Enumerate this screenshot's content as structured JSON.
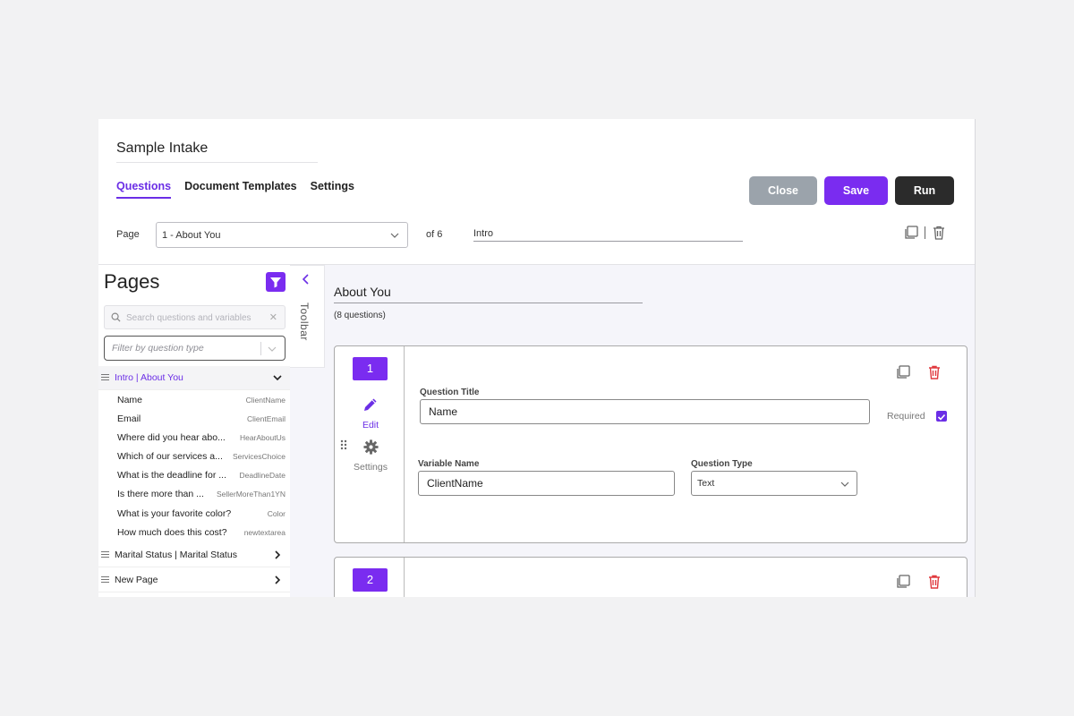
{
  "app": {
    "title": "Sample Intake"
  },
  "tabs": [
    {
      "label": "Questions",
      "active": true
    },
    {
      "label": "Document Templates",
      "active": false
    },
    {
      "label": "Settings",
      "active": false
    }
  ],
  "actions": {
    "close_label": "Close",
    "save_label": "Save",
    "run_label": "Run"
  },
  "page_nav": {
    "label": "Page",
    "selected": "1 - About You",
    "of_label": "of 6",
    "page_name": "Intro"
  },
  "sidebar": {
    "title": "Pages",
    "search_placeholder": "Search questions and variables",
    "filter_placeholder": "Filter by question type",
    "groups": [
      {
        "label": "Intro | About You",
        "expanded": true
      },
      {
        "label": "Marital Status | Marital Status",
        "expanded": false
      },
      {
        "label": "New Page",
        "expanded": false
      }
    ],
    "questions": [
      {
        "title": "Name",
        "variable": "ClientName"
      },
      {
        "title": "Email",
        "variable": "ClientEmail"
      },
      {
        "title": "Where did you hear abo...",
        "variable": "HearAboutUs"
      },
      {
        "title": "Which of our services a...",
        "variable": "ServicesChoice"
      },
      {
        "title": "What is the deadline for ...",
        "variable": "DeadlineDate"
      },
      {
        "title": "Is there more than ...",
        "variable": "SellerMoreThan1YN"
      },
      {
        "title": "What is your favorite color?",
        "variable": "Color"
      },
      {
        "title": "How much does this cost?",
        "variable": "newtextarea"
      }
    ]
  },
  "toolbar": {
    "label": "Toolbar"
  },
  "main": {
    "page_heading": "About You",
    "question_count": "(8 questions)",
    "cards": [
      {
        "number": "1",
        "edit_label": "Edit",
        "settings_label": "Settings",
        "question_title_label": "Question Title",
        "question_title_value": "Name",
        "required_label": "Required",
        "required": true,
        "variable_name_label": "Variable Name",
        "variable_name_value": "ClientName",
        "question_type_label": "Question Type",
        "question_type_value": "Text"
      },
      {
        "number": "2"
      }
    ]
  },
  "colors": {
    "accent": "#7a2cf0",
    "close_button": "#9ba3ab",
    "run_button": "#2b2b2b",
    "delete_icon": "#e0393e"
  },
  "icons": [
    "copy-icon",
    "trash-icon",
    "filter-icon",
    "search-icon",
    "chevron-down-icon",
    "chevron-left-icon",
    "chevron-right-icon",
    "pencil-icon",
    "gear-icon",
    "drag-handle-icon",
    "checkbox-checked-icon"
  ]
}
